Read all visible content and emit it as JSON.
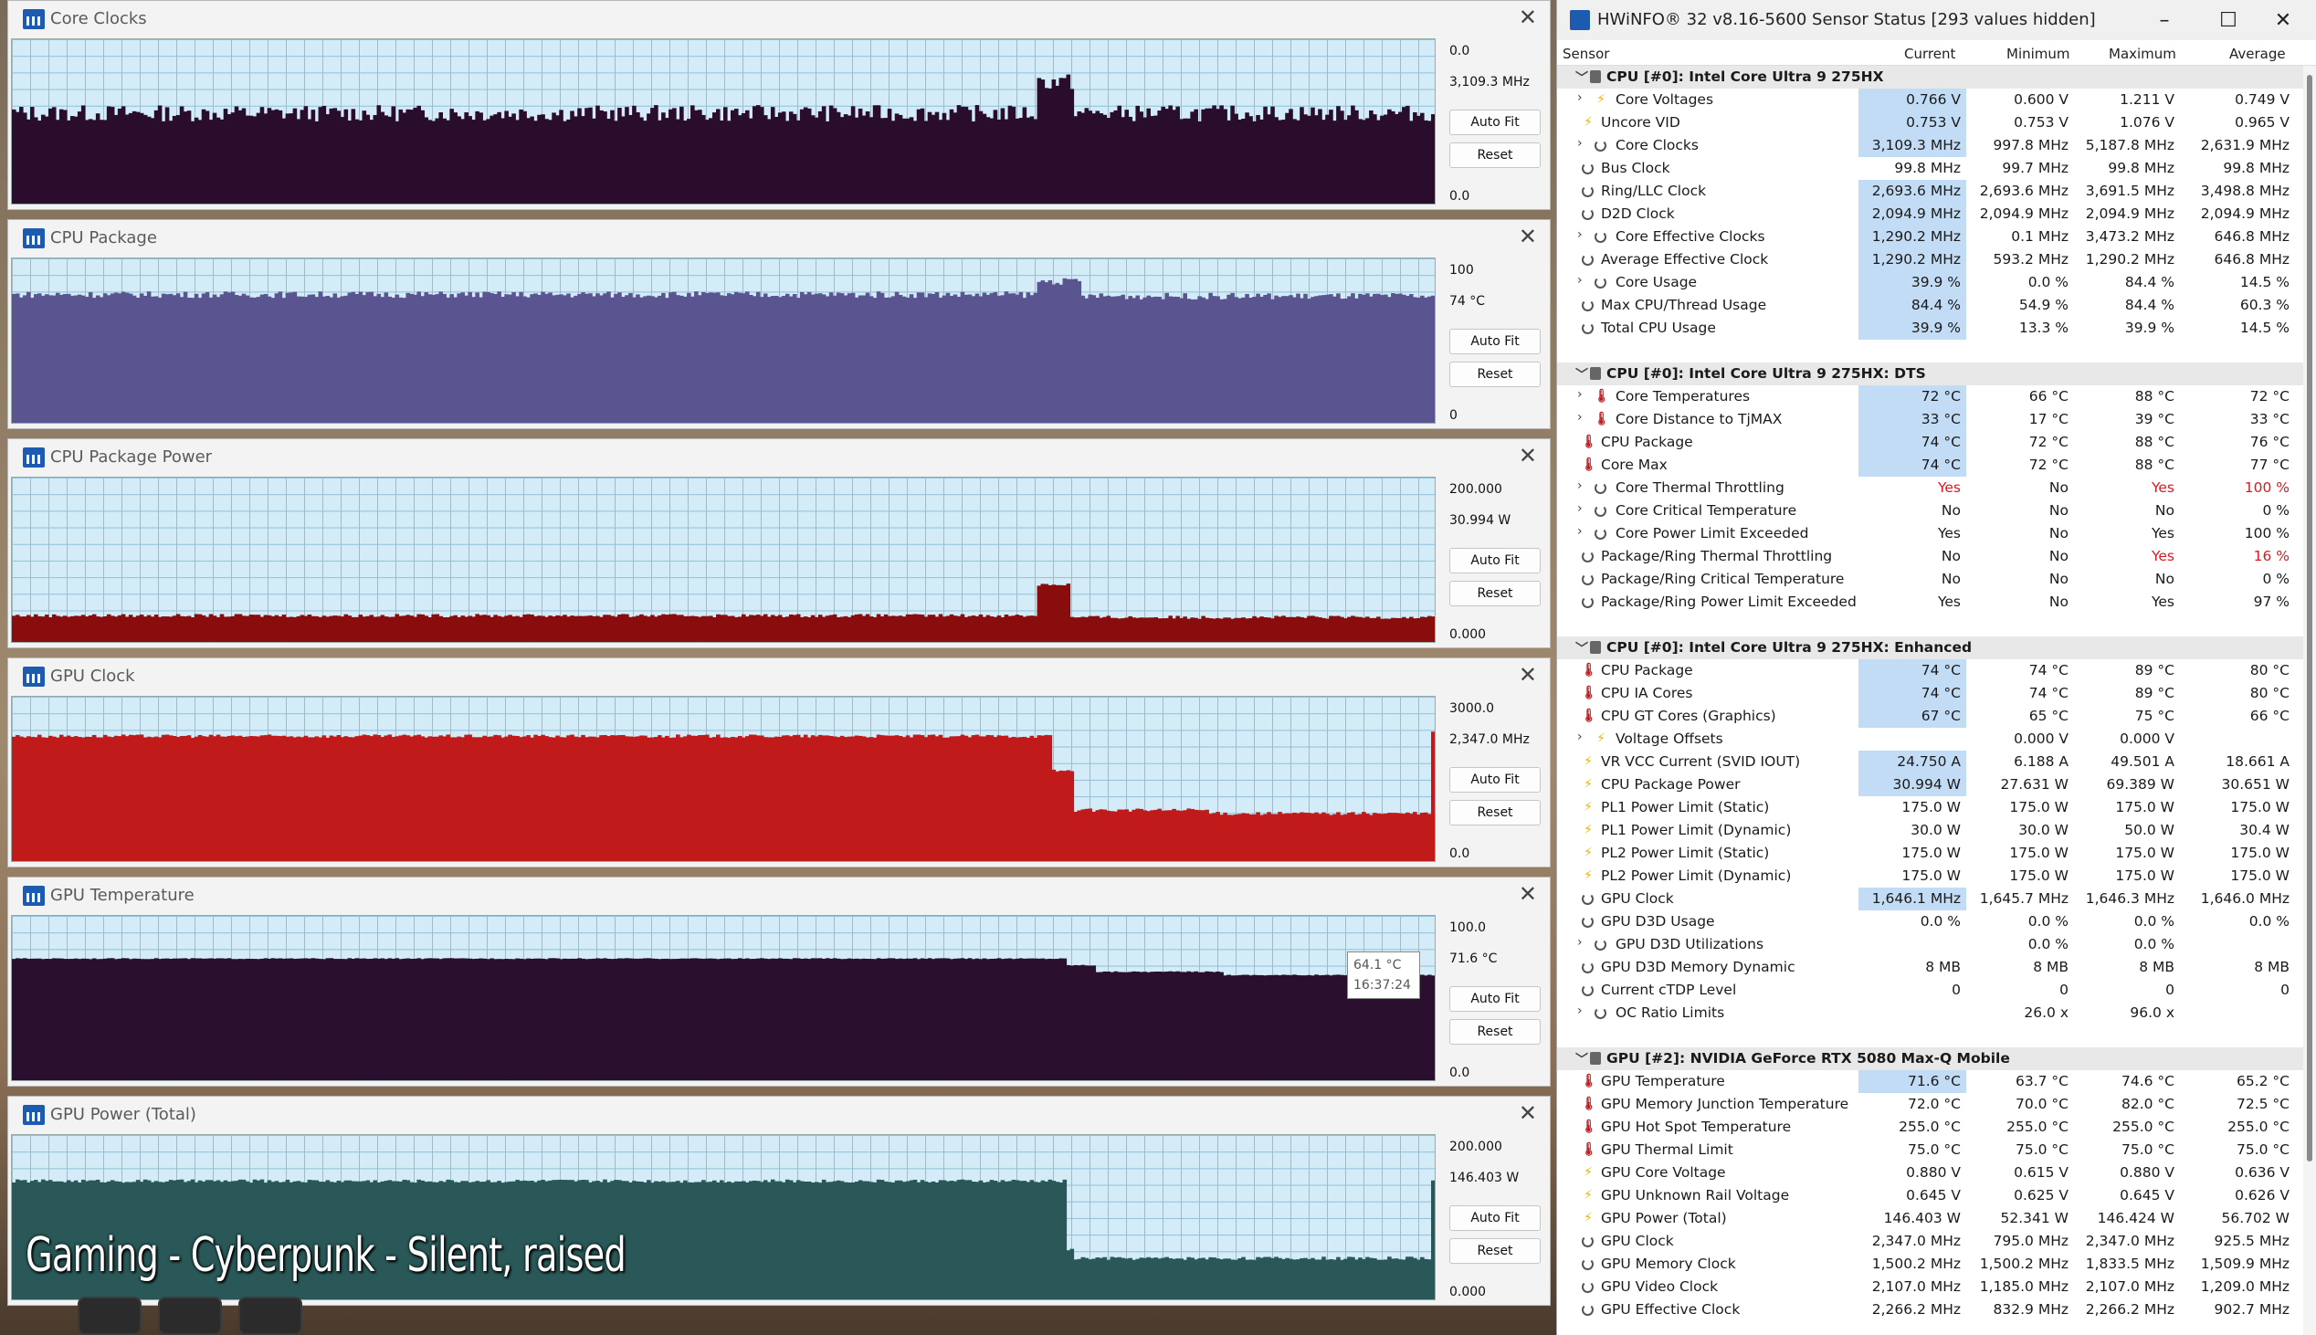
{
  "overlay_text": "Gaming - Cyberpunk - Silent, raised",
  "graphs": [
    {
      "title": "Core Clocks",
      "top_value": "0.0",
      "current": "3,109.3 MHz",
      "bottom": "0.0",
      "color": "#2a0d2c",
      "auto_fit": "Auto Fit",
      "reset": "Reset"
    },
    {
      "title": "CPU Package",
      "top_value": "100",
      "current": "74 °C",
      "bottom": "0",
      "color": "#5a5590",
      "auto_fit": "Auto Fit",
      "reset": "Reset"
    },
    {
      "title": "CPU Package Power",
      "top_value": "200.000",
      "current": "30.994 W",
      "bottom": "0.000",
      "color": "#8a0d0d",
      "auto_fit": "Auto Fit",
      "reset": "Reset"
    },
    {
      "title": "GPU Clock",
      "top_value": "3000.0",
      "current": "2,347.0 MHz",
      "bottom": "0.0",
      "color": "#c01a1a",
      "auto_fit": "Auto Fit",
      "reset": "Reset"
    },
    {
      "title": "GPU Temperature",
      "top_value": "100.0",
      "current": "71.6 °C",
      "bottom": "0.0",
      "color": "#2b0f2f",
      "auto_fit": "Auto Fit",
      "reset": "Reset"
    },
    {
      "title": "GPU Power (Total)",
      "top_value": "200.000",
      "current": "146.403 W",
      "bottom": "0.000",
      "color": "#2a5858",
      "auto_fit": "Auto Fit",
      "reset": "Reset"
    }
  ],
  "tooltip": {
    "value": "64.1 °C",
    "time": "16:37:24"
  },
  "hwinfo": {
    "title": "HWiNFO® 32 v8.16-5600 Sensor Status [293 values hidden]",
    "headers": {
      "sensor": "Sensor",
      "current": "Current",
      "minimum": "Minimum",
      "maximum": "Maximum",
      "average": "Average"
    },
    "rows": [
      {
        "type": "group",
        "name": "CPU [#0]: Intel Core Ultra 9 275HX"
      },
      {
        "name": "Core Voltages",
        "icon": "volt",
        "expand": true,
        "cur": "0.766 V",
        "min": "0.600 V",
        "max": "1.211 V",
        "avg": "0.749 V",
        "hl": true
      },
      {
        "name": "Uncore VID",
        "icon": "volt",
        "cur": "0.753 V",
        "min": "0.753 V",
        "max": "1.076 V",
        "avg": "0.965 V",
        "hl": true
      },
      {
        "name": "Core Clocks",
        "icon": "clock",
        "expand": true,
        "cur": "3,109.3 MHz",
        "min": "997.8 MHz",
        "max": "5,187.8 MHz",
        "avg": "2,631.9 MHz",
        "hl": true
      },
      {
        "name": "Bus Clock",
        "icon": "clock",
        "cur": "99.8 MHz",
        "min": "99.7 MHz",
        "max": "99.8 MHz",
        "avg": "99.8 MHz"
      },
      {
        "name": "Ring/LLC Clock",
        "icon": "clock",
        "cur": "2,693.6 MHz",
        "min": "2,693.6 MHz",
        "max": "3,691.5 MHz",
        "avg": "3,498.8 MHz",
        "hl": true
      },
      {
        "name": "D2D Clock",
        "icon": "clock",
        "cur": "2,094.9 MHz",
        "min": "2,094.9 MHz",
        "max": "2,094.9 MHz",
        "avg": "2,094.9 MHz",
        "hl": true
      },
      {
        "name": "Core Effective Clocks",
        "icon": "clock",
        "expand": true,
        "cur": "1,290.2 MHz",
        "min": "0.1 MHz",
        "max": "3,473.2 MHz",
        "avg": "646.8 MHz",
        "hl": true
      },
      {
        "name": "Average Effective Clock",
        "icon": "clock",
        "cur": "1,290.2 MHz",
        "min": "593.2 MHz",
        "max": "1,290.2 MHz",
        "avg": "646.8 MHz",
        "hl": true
      },
      {
        "name": "Core Usage",
        "icon": "clock",
        "expand": true,
        "cur": "39.9 %",
        "min": "0.0 %",
        "max": "84.4 %",
        "avg": "14.5 %",
        "hl": true
      },
      {
        "name": "Max CPU/Thread Usage",
        "icon": "clock",
        "cur": "84.4 %",
        "min": "54.9 %",
        "max": "84.4 %",
        "avg": "60.3 %",
        "hl": true
      },
      {
        "name": "Total CPU Usage",
        "icon": "clock",
        "cur": "39.9 %",
        "min": "13.3 %",
        "max": "39.9 %",
        "avg": "14.5 %",
        "hl": true
      },
      {
        "type": "blank"
      },
      {
        "type": "group",
        "name": "CPU [#0]: Intel Core Ultra 9 275HX: DTS"
      },
      {
        "name": "Core Temperatures",
        "icon": "temp",
        "expand": true,
        "cur": "72 °C",
        "min": "66 °C",
        "max": "88 °C",
        "avg": "72 °C",
        "hl": true
      },
      {
        "name": "Core Distance to TjMAX",
        "icon": "temp",
        "expand": true,
        "cur": "33 °C",
        "min": "17 °C",
        "max": "39 °C",
        "avg": "33 °C",
        "hl": true
      },
      {
        "name": "CPU Package",
        "icon": "temp",
        "cur": "74 °C",
        "min": "72 °C",
        "max": "88 °C",
        "avg": "76 °C",
        "hl": true
      },
      {
        "name": "Core Max",
        "icon": "temp",
        "cur": "74 °C",
        "min": "72 °C",
        "max": "88 °C",
        "avg": "77 °C",
        "hl": true
      },
      {
        "name": "Core Thermal Throttling",
        "icon": "clock",
        "expand": true,
        "cur": "Yes",
        "min": "No",
        "max": "Yes",
        "avg": "100 %",
        "red": [
          "cur",
          "max",
          "avg"
        ]
      },
      {
        "name": "Core Critical Temperature",
        "icon": "clock",
        "expand": true,
        "cur": "No",
        "min": "No",
        "max": "No",
        "avg": "0 %"
      },
      {
        "name": "Core Power Limit Exceeded",
        "icon": "clock",
        "expand": true,
        "cur": "Yes",
        "min": "No",
        "max": "Yes",
        "avg": "100 %"
      },
      {
        "name": "Package/Ring Thermal Throttling",
        "icon": "clock",
        "cur": "No",
        "min": "No",
        "max": "Yes",
        "avg": "16 %",
        "red": [
          "max",
          "avg"
        ]
      },
      {
        "name": "Package/Ring Critical Temperature",
        "icon": "clock",
        "cur": "No",
        "min": "No",
        "max": "No",
        "avg": "0 %"
      },
      {
        "name": "Package/Ring Power Limit Exceeded",
        "icon": "clock",
        "cur": "Yes",
        "min": "No",
        "max": "Yes",
        "avg": "97 %"
      },
      {
        "type": "blank"
      },
      {
        "type": "group",
        "name": "CPU [#0]: Intel Core Ultra 9 275HX: Enhanced"
      },
      {
        "name": "CPU Package",
        "icon": "temp",
        "cur": "74 °C",
        "min": "74 °C",
        "max": "89 °C",
        "avg": "80 °C",
        "hl": true
      },
      {
        "name": "CPU IA Cores",
        "icon": "temp",
        "cur": "74 °C",
        "min": "74 °C",
        "max": "89 °C",
        "avg": "80 °C",
        "hl": true
      },
      {
        "name": "CPU GT Cores (Graphics)",
        "icon": "temp",
        "cur": "67 °C",
        "min": "65 °C",
        "max": "75 °C",
        "avg": "66 °C",
        "hl": true
      },
      {
        "name": "Voltage Offsets",
        "icon": "volt",
        "expand": true,
        "cur": "",
        "min": "0.000 V",
        "max": "0.000 V",
        "avg": ""
      },
      {
        "name": "VR VCC Current (SVID IOUT)",
        "icon": "volt",
        "cur": "24.750 A",
        "min": "6.188 A",
        "max": "49.501 A",
        "avg": "18.661 A",
        "hl": true
      },
      {
        "name": "CPU Package Power",
        "icon": "volt",
        "cur": "30.994 W",
        "min": "27.631 W",
        "max": "69.389 W",
        "avg": "30.651 W",
        "hl": true
      },
      {
        "name": "PL1 Power Limit (Static)",
        "icon": "volt",
        "cur": "175.0 W",
        "min": "175.0 W",
        "max": "175.0 W",
        "avg": "175.0 W"
      },
      {
        "name": "PL1 Power Limit (Dynamic)",
        "icon": "volt",
        "cur": "30.0 W",
        "min": "30.0 W",
        "max": "50.0 W",
        "avg": "30.4 W"
      },
      {
        "name": "PL2 Power Limit (Static)",
        "icon": "volt",
        "cur": "175.0 W",
        "min": "175.0 W",
        "max": "175.0 W",
        "avg": "175.0 W"
      },
      {
        "name": "PL2 Power Limit (Dynamic)",
        "icon": "volt",
        "cur": "175.0 W",
        "min": "175.0 W",
        "max": "175.0 W",
        "avg": "175.0 W"
      },
      {
        "name": "GPU Clock",
        "icon": "clock",
        "cur": "1,646.1 MHz",
        "min": "1,645.7 MHz",
        "max": "1,646.3 MHz",
        "avg": "1,646.0 MHz",
        "hl": true
      },
      {
        "name": "GPU D3D Usage",
        "icon": "clock",
        "cur": "0.0 %",
        "min": "0.0 %",
        "max": "0.0 %",
        "avg": "0.0 %"
      },
      {
        "name": "GPU D3D Utilizations",
        "icon": "clock",
        "expand": true,
        "cur": "",
        "min": "0.0 %",
        "max": "0.0 %",
        "avg": ""
      },
      {
        "name": "GPU D3D Memory Dynamic",
        "icon": "clock",
        "cur": "8 MB",
        "min": "8 MB",
        "max": "8 MB",
        "avg": "8 MB"
      },
      {
        "name": "Current cTDP Level",
        "icon": "clock",
        "cur": "0",
        "min": "0",
        "max": "0",
        "avg": "0"
      },
      {
        "name": "OC Ratio Limits",
        "icon": "clock",
        "expand": true,
        "cur": "",
        "min": "26.0 x",
        "max": "96.0 x",
        "avg": ""
      },
      {
        "type": "blank"
      },
      {
        "type": "group",
        "name": "GPU [#2]: NVIDIA  GeForce RTX 5080 Max-Q Mobile"
      },
      {
        "name": "GPU Temperature",
        "icon": "temp",
        "cur": "71.6 °C",
        "min": "63.7 °C",
        "max": "74.6 °C",
        "avg": "65.2 °C",
        "hl": true
      },
      {
        "name": "GPU Memory Junction Temperature",
        "icon": "temp",
        "cur": "72.0 °C",
        "min": "70.0 °C",
        "max": "82.0 °C",
        "avg": "72.5 °C"
      },
      {
        "name": "GPU Hot Spot Temperature",
        "icon": "temp",
        "cur": "255.0 °C",
        "min": "255.0 °C",
        "max": "255.0 °C",
        "avg": "255.0 °C"
      },
      {
        "name": "GPU Thermal Limit",
        "icon": "temp",
        "cur": "75.0 °C",
        "min": "75.0 °C",
        "max": "75.0 °C",
        "avg": "75.0 °C"
      },
      {
        "name": "GPU Core Voltage",
        "icon": "volt",
        "cur": "0.880 V",
        "min": "0.615 V",
        "max": "0.880 V",
        "avg": "0.636 V"
      },
      {
        "name": "GPU Unknown Rail Voltage",
        "icon": "volt",
        "expand": false,
        "indent": true,
        "cur": "0.645 V",
        "min": "0.625 V",
        "max": "0.645 V",
        "avg": "0.626 V"
      },
      {
        "name": "GPU Power (Total)",
        "icon": "volt",
        "cur": "146.403 W",
        "min": "52.341 W",
        "max": "146.424 W",
        "avg": "56.702 W"
      },
      {
        "name": "GPU Clock",
        "icon": "clock",
        "cur": "2,347.0 MHz",
        "min": "795.0 MHz",
        "max": "2,347.0 MHz",
        "avg": "925.5 MHz"
      },
      {
        "name": "GPU Memory Clock",
        "icon": "clock",
        "cur": "1,500.2 MHz",
        "min": "1,500.2 MHz",
        "max": "1,833.5 MHz",
        "avg": "1,509.9 MHz"
      },
      {
        "name": "GPU Video Clock",
        "icon": "clock",
        "cur": "2,107.0 MHz",
        "min": "1,185.0 MHz",
        "max": "2,107.0 MHz",
        "avg": "1,209.0 MHz"
      },
      {
        "name": "GPU Effective Clock",
        "icon": "clock",
        "cur": "2,266.2 MHz",
        "min": "832.9 MHz",
        "max": "2,266.2 MHz",
        "avg": "902.7 MHz"
      }
    ]
  },
  "chart_data": [
    {
      "type": "area",
      "title": "Core Clocks",
      "ylim": [
        0,
        0
      ],
      "segments": [
        {
          "from": 0,
          "to": 0.72,
          "level": 0.55
        },
        {
          "from": 0.72,
          "to": 0.745,
          "level": 0.74
        },
        {
          "from": 0.745,
          "to": 1,
          "level": 0.55
        }
      ],
      "jitter": 0.05
    },
    {
      "type": "area",
      "title": "CPU Package",
      "ylim": [
        0,
        100
      ],
      "segments": [
        {
          "from": 0,
          "to": 0.72,
          "level": 0.78
        },
        {
          "from": 0.72,
          "to": 0.75,
          "level": 0.86
        },
        {
          "from": 0.75,
          "to": 1,
          "level": 0.77
        }
      ],
      "jitter": 0.02
    },
    {
      "type": "area",
      "title": "CPU Package Power",
      "ylim": [
        0,
        200
      ],
      "segments": [
        {
          "from": 0,
          "to": 0.72,
          "level": 0.16
        },
        {
          "from": 0.72,
          "to": 0.743,
          "level": 0.35
        },
        {
          "from": 0.743,
          "to": 1,
          "level": 0.15
        }
      ],
      "jitter": 0.01
    },
    {
      "type": "area",
      "title": "GPU Clock",
      "ylim": [
        0,
        3000
      ],
      "segments": [
        {
          "from": 0,
          "to": 0.73,
          "level": 0.76
        },
        {
          "from": 0.73,
          "to": 0.745,
          "level": 0.55
        },
        {
          "from": 0.745,
          "to": 0.84,
          "level": 0.31
        },
        {
          "from": 0.84,
          "to": 0.995,
          "level": 0.29
        },
        {
          "from": 0.995,
          "to": 1,
          "level": 0.78
        }
      ],
      "jitter": 0.01
    },
    {
      "type": "area",
      "title": "GPU Temperature",
      "ylim": [
        0,
        100
      ],
      "segments": [
        {
          "from": 0,
          "to": 0.74,
          "level": 0.74
        },
        {
          "from": 0.74,
          "to": 0.76,
          "level": 0.7
        },
        {
          "from": 0.76,
          "to": 0.85,
          "level": 0.66
        },
        {
          "from": 0.85,
          "to": 1,
          "level": 0.64
        }
      ],
      "jitter": 0.003
    },
    {
      "type": "area",
      "title": "GPU Power (Total)",
      "ylim": [
        0,
        200
      ],
      "segments": [
        {
          "from": 0,
          "to": 0.74,
          "level": 0.72
        },
        {
          "from": 0.74,
          "to": 0.745,
          "level": 0.3
        },
        {
          "from": 0.745,
          "to": 0.995,
          "level": 0.25
        },
        {
          "from": 0.995,
          "to": 1,
          "level": 0.73
        }
      ],
      "jitter": 0.01
    }
  ]
}
